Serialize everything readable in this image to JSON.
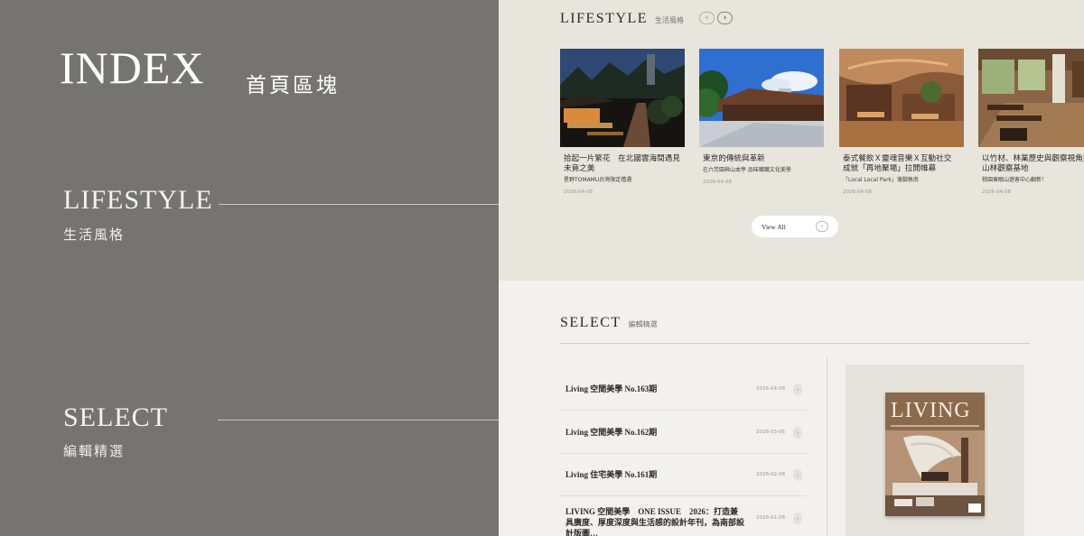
{
  "left": {
    "index_title": "INDEX",
    "index_subtitle": "首頁區塊",
    "lifestyle_title": "LIFESTYLE",
    "lifestyle_subtitle": "生活風格",
    "select_title": "SELECT",
    "select_subtitle": "編輯精選"
  },
  "lifestyle": {
    "title": "LIFESTYLE",
    "subtitle": "生活風格",
    "prev_icon": "‹",
    "next_icon": "›",
    "cards": [
      {
        "title": "拾起一片繁花　在北國雲海間遇見未竟之美",
        "subtitle": "星野TOMAMU台灣限定禮遇",
        "date": "2026-04-08"
      },
      {
        "title": "東京的傳統與革新",
        "subtitle": "在六芳園與山本亭 品味職職文化美學",
        "date": "2026-04-08"
      },
      {
        "title": "泰式餐飲Ｘ靈魂音樂Ｘ互動社交　成就「再地聚場」拉開帷幕",
        "subtitle": "「Local Local Park」落腳敦南",
        "date": "2026-04-08"
      },
      {
        "title": "以竹材、林業歷史與觀察視角打造山林觀察基地",
        "subtitle": "桃園東眼山遊客中心翻新！",
        "date": "2026-04-08"
      }
    ],
    "view_all": "View All",
    "view_all_icon": "›"
  },
  "select": {
    "title": "SELECT",
    "subtitle": "編輯精選",
    "arrow_icon": "›",
    "issues": [
      {
        "title": "Living 空間美學 No.163期",
        "date": "2026-04-08"
      },
      {
        "title": "Living 空間美學 No.162期",
        "date": "2026-03-06"
      },
      {
        "title": "Living 住宅美學 No.161期",
        "date": "2026-02-08"
      },
      {
        "title": "LIVING 空間美學　ONE ISSUE　2026：打造兼具廣度、厚度深度與生活感的設計年刊，為南部設計版圖…",
        "date": "2026-01-08"
      }
    ],
    "magazine_logo": "LIVING"
  }
}
